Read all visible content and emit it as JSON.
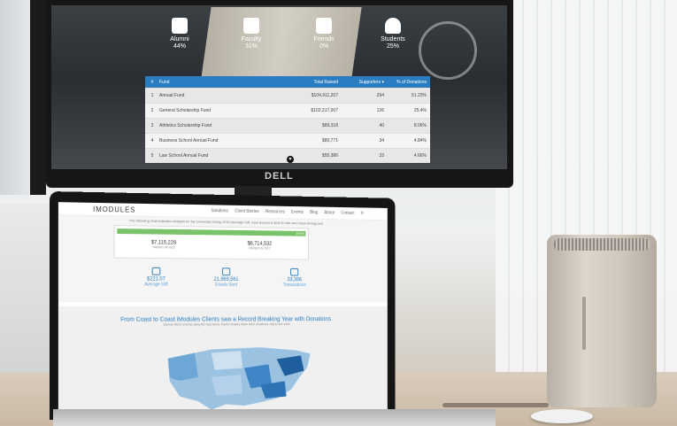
{
  "monitor": {
    "brand": "DELL",
    "stats": [
      {
        "name": "Alumni",
        "value": "44%",
        "icon": "graduation-cap-icon"
      },
      {
        "name": "Faculty",
        "value": "31%",
        "icon": "chalkboard-icon"
      },
      {
        "name": "Friends",
        "value": "0%",
        "icon": "handshake-icon"
      },
      {
        "name": "Students",
        "value": "25%",
        "icon": "person-icon"
      }
    ],
    "table": {
      "headers": [
        "#",
        "Fund",
        "Total Raised",
        "Supporters ▾",
        "% of Donations"
      ],
      "rows": [
        [
          "1",
          "Annual Fund",
          "$104,911,207",
          "294",
          "51.23%"
        ],
        [
          "2",
          "General Scholarship Fund",
          "$102,317,007",
          "126",
          "25.4%"
        ],
        [
          "3",
          "Athletics Scholarship Fund",
          "$89,318",
          "40",
          "8.06%"
        ],
        [
          "4",
          "Business School Annual Fund",
          "$80,771",
          "34",
          "4.84%"
        ],
        [
          "5",
          "Law School Annual Fund",
          "$55,386",
          "33",
          "4.66%"
        ]
      ]
    }
  },
  "laptop": {
    "logo": "IMODULES",
    "nav": [
      "Solutions",
      "Client Stories",
      "Resources",
      "Events",
      "Blog",
      "About",
      "Contact"
    ],
    "tagline": "The following chart indicates analysis for the University Giving 2015 (Average Gift, Goal amount is $15.00 with and Class Giving) and",
    "progress_label": "100%",
    "progress_percent": 100,
    "amounts": [
      {
        "value": "$7,115,228",
        "label": "RAISED IN 2015"
      },
      {
        "value": "$6,714,532",
        "label": "RAISED IN 2017"
      }
    ],
    "metrics": [
      {
        "value": "$221.07",
        "label": "Average Gift",
        "icon": "gift-icon"
      },
      {
        "value": "21,969,561",
        "label": "Emails Sent",
        "icon": "envelope-icon"
      },
      {
        "value": "33,396",
        "label": "Transactions",
        "icon": "money-icon"
      }
    ],
    "map_title": "From Coast to Coast iModules Clients saw a Record Breaking Year with Donations",
    "map_subtitle": "Explore client revenue using the map below. Darker shades mean more donations. Ask to see more."
  },
  "colors": {
    "accent": "#2a7dc1",
    "progress": "#7bc36a"
  }
}
